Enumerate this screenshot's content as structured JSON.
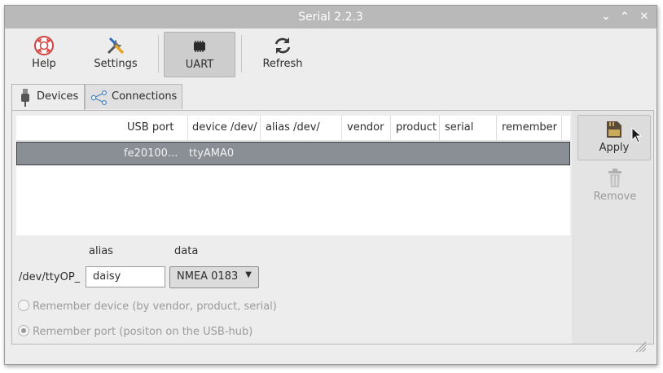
{
  "window": {
    "title": "Serial 2.2.3",
    "controls": [
      "minimize-chevron",
      "maximize-chevron",
      "close"
    ]
  },
  "toolbar": {
    "help_label": "Help",
    "settings_label": "Settings",
    "uart_label": "UART",
    "refresh_label": "Refresh"
  },
  "tabs": [
    {
      "label": "Devices",
      "icon": "usb-plug-icon",
      "active": true
    },
    {
      "label": "Connections",
      "icon": "share-icon",
      "active": false
    }
  ],
  "table": {
    "columns": [
      "USB port",
      "device /dev/",
      "alias /dev/",
      "vendor",
      "product",
      "serial",
      "remember"
    ],
    "rows": [
      {
        "usb_port": "fe20100...",
        "device": "ttyAMA0",
        "alias": "",
        "vendor": "",
        "product": "",
        "serial": "",
        "remember": ""
      }
    ]
  },
  "actions": {
    "apply_label": "Apply",
    "remove_label": "Remove"
  },
  "form": {
    "alias_header": "alias",
    "data_header": "data",
    "prefix": "/dev/ttyOP_",
    "alias_value": "daisy",
    "data_value": "NMEA 0183"
  },
  "options": {
    "remember_device": "Remember device (by vendor, product, serial)",
    "remember_port": "Remember port (positon on the USB-hub)"
  },
  "colors": {
    "titlebar": "#b9b9b9",
    "selection": "#8a8f96",
    "help_icon": "#e04b4b"
  }
}
